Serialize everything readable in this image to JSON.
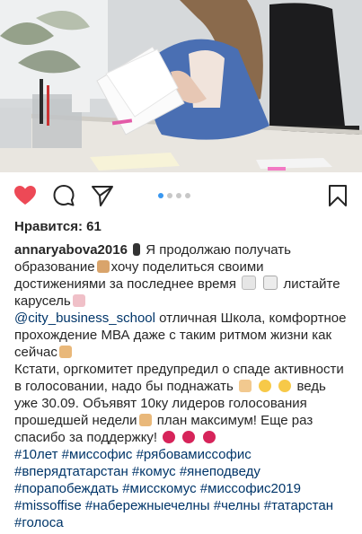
{
  "post": {
    "likes_label": "Нравится: 61",
    "carousel": {
      "total": 4,
      "active": 1
    },
    "caption": {
      "username": "annaryabova2016",
      "text_1": " Я продолжаю получать образование",
      "text_2": "хочу поделиться своими достижениями за последнее время ",
      "text_3": " листайте карусель",
      "mention": "@city_business_school",
      "text_4": " отличная Школа, комфортное прохождение МВА даже с таким ритмом жизни как сейчас",
      "text_5": "Кстати, оргкомитет предупредил о спаде активности в голосовании, надо бы поднажать",
      "text_6": " ведь уже 30.09. Объявят 10ку лидеров голосования прошедшей недели",
      "text_7": " план максимум! Еще раз спасибо за поддержку!",
      "hashtags": "#10лет #миссофис #рябовамиссофис #вперядтатарстан #комус #янеподведу #порапобеждать #мисскомус #миссофис2019 #missoffise #набережныечелны #челны #татарстан #голоса"
    }
  },
  "icons": {
    "like": "heart-icon",
    "comment": "comment-icon",
    "share": "send-icon",
    "save": "bookmark-icon"
  },
  "colors": {
    "like_red": "#ed4956",
    "link_blue": "#003569",
    "dot_active": "#3897f0"
  }
}
